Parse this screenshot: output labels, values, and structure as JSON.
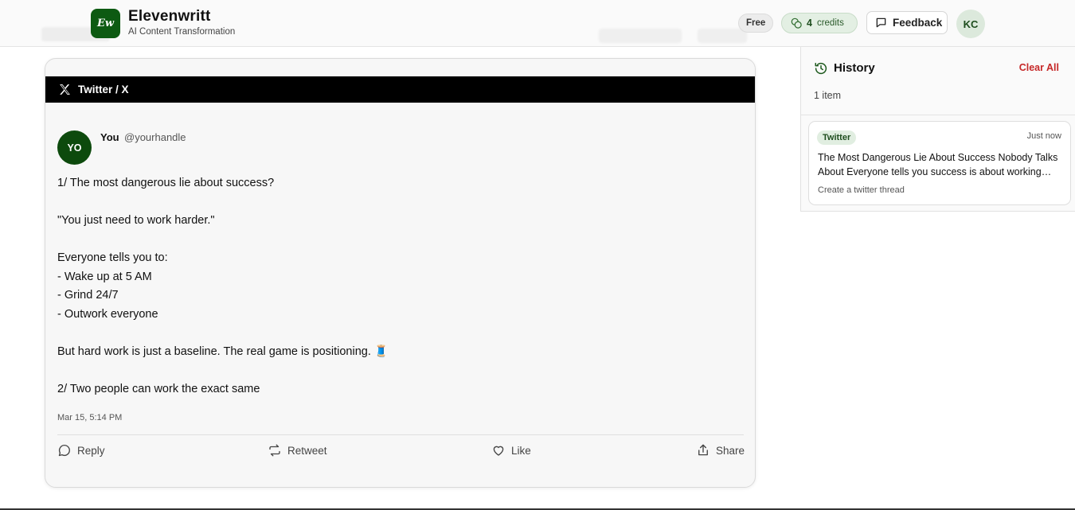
{
  "header": {
    "logo_text": "Ew",
    "brand_name": "Elevenwritt",
    "brand_tagline": "AI Content Transformation",
    "plan_badge": "Free",
    "credits_count": "4",
    "credits_label": "credits",
    "feedback_label": "Feedback",
    "user_initials": "KC"
  },
  "tweet": {
    "platform_label": "Twitter / X",
    "avatar_initials": "YO",
    "author_name": "You",
    "author_handle": "@yourhandle",
    "body": "1/ The most dangerous lie about success?\n\n\"You just need to work harder.\"\n\nEveryone tells you to:\n- Wake up at 5 AM\n- Grind 24/7\n- Outwork everyone\n\nBut hard work is just a baseline. The real game is positioning. 🧵\n\n2/ Two people can work the exact same",
    "timestamp": "Mar 15, 5:14 PM",
    "actions": {
      "reply": "Reply",
      "retweet": "Retweet",
      "like": "Like",
      "share": "Share"
    }
  },
  "history": {
    "title": "History",
    "clear_label": "Clear All",
    "count_label": "1 item",
    "items": [
      {
        "tag": "Twitter",
        "time": "Just now",
        "text": "The Most Dangerous Lie About Success Nobody Talks About Everyone tells you success is about working harder",
        "subtitle": "Create a twitter thread"
      }
    ]
  },
  "colors": {
    "brand_green": "#0d5a12",
    "clear_red": "#c62828",
    "tweet_bar": "#000000"
  }
}
